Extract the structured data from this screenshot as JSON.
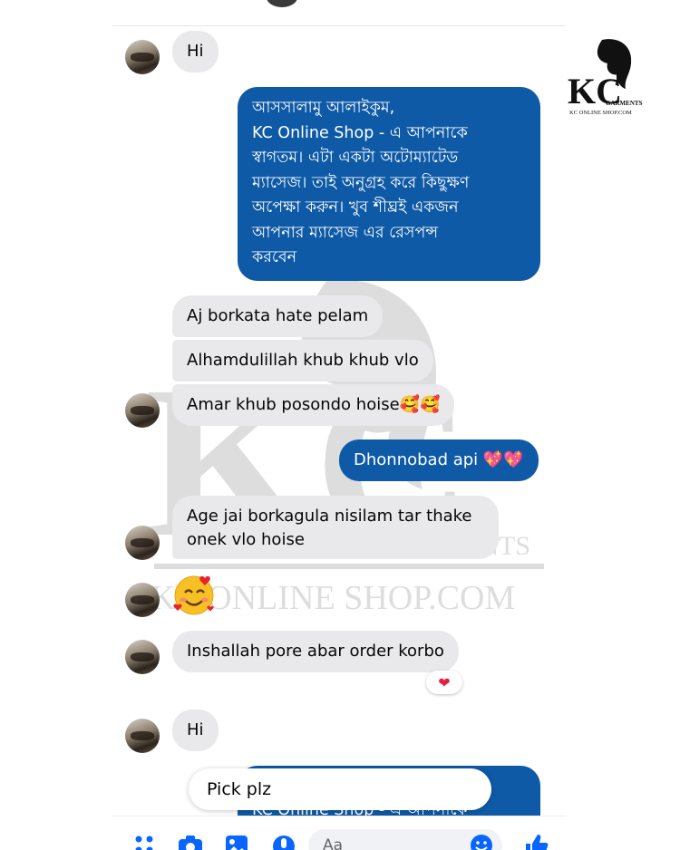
{
  "logo": {
    "brand": "KC",
    "line1": "GARMENTS",
    "line2": "KC ONLINE SHOP.COM"
  },
  "watermark": {
    "letters": "KC",
    "line1": "GARMENTS",
    "line2": "KC ONLINE SHOP.COM"
  },
  "messages": {
    "m1": "Hi",
    "auto_reply": "আসসালামু আলাইকুম,\nKC Online Shop - এ আপনাকে\nস্বাগতম। এটা একটা অটোম্যাটেড\nম্যাসেজ। তাই অনুগ্রহ করে কিছুক্ষণ\nঅপেক্ষা করুন। খুব শীঘ্রই একজন\nআপনার ম্যাসেজ এর রেসপন্স\nকরবেন",
    "m2": "Aj borkata hate pelam",
    "m3": "Alhamdulillah  khub khub vlo",
    "m4": "Amar khub posondo hoise🥰🥰",
    "m5": "Dhonnobad api 💖💖",
    "m6": "Age jai borkagula nisilam tar thake\nonek vlo hoise",
    "m7_emoji": "🥰",
    "m8": "Inshallah pore abar order  korbo",
    "m8_reaction": "❤",
    "m9": "Hi",
    "auto_reply_partial": "KC Online Shop - এ আপনাকে"
  },
  "popup": {
    "text": "Pick plz"
  },
  "composer": {
    "placeholder": "Aa",
    "icons": [
      "grid-menu-icon",
      "camera-icon",
      "gallery-icon",
      "microphone-icon",
      "emoji-icon",
      "like-icon"
    ]
  },
  "colors": {
    "outgoing_bubble": "#0e5aa7",
    "incoming_bubble": "#e9e9eb",
    "accent": "#0866ff"
  }
}
